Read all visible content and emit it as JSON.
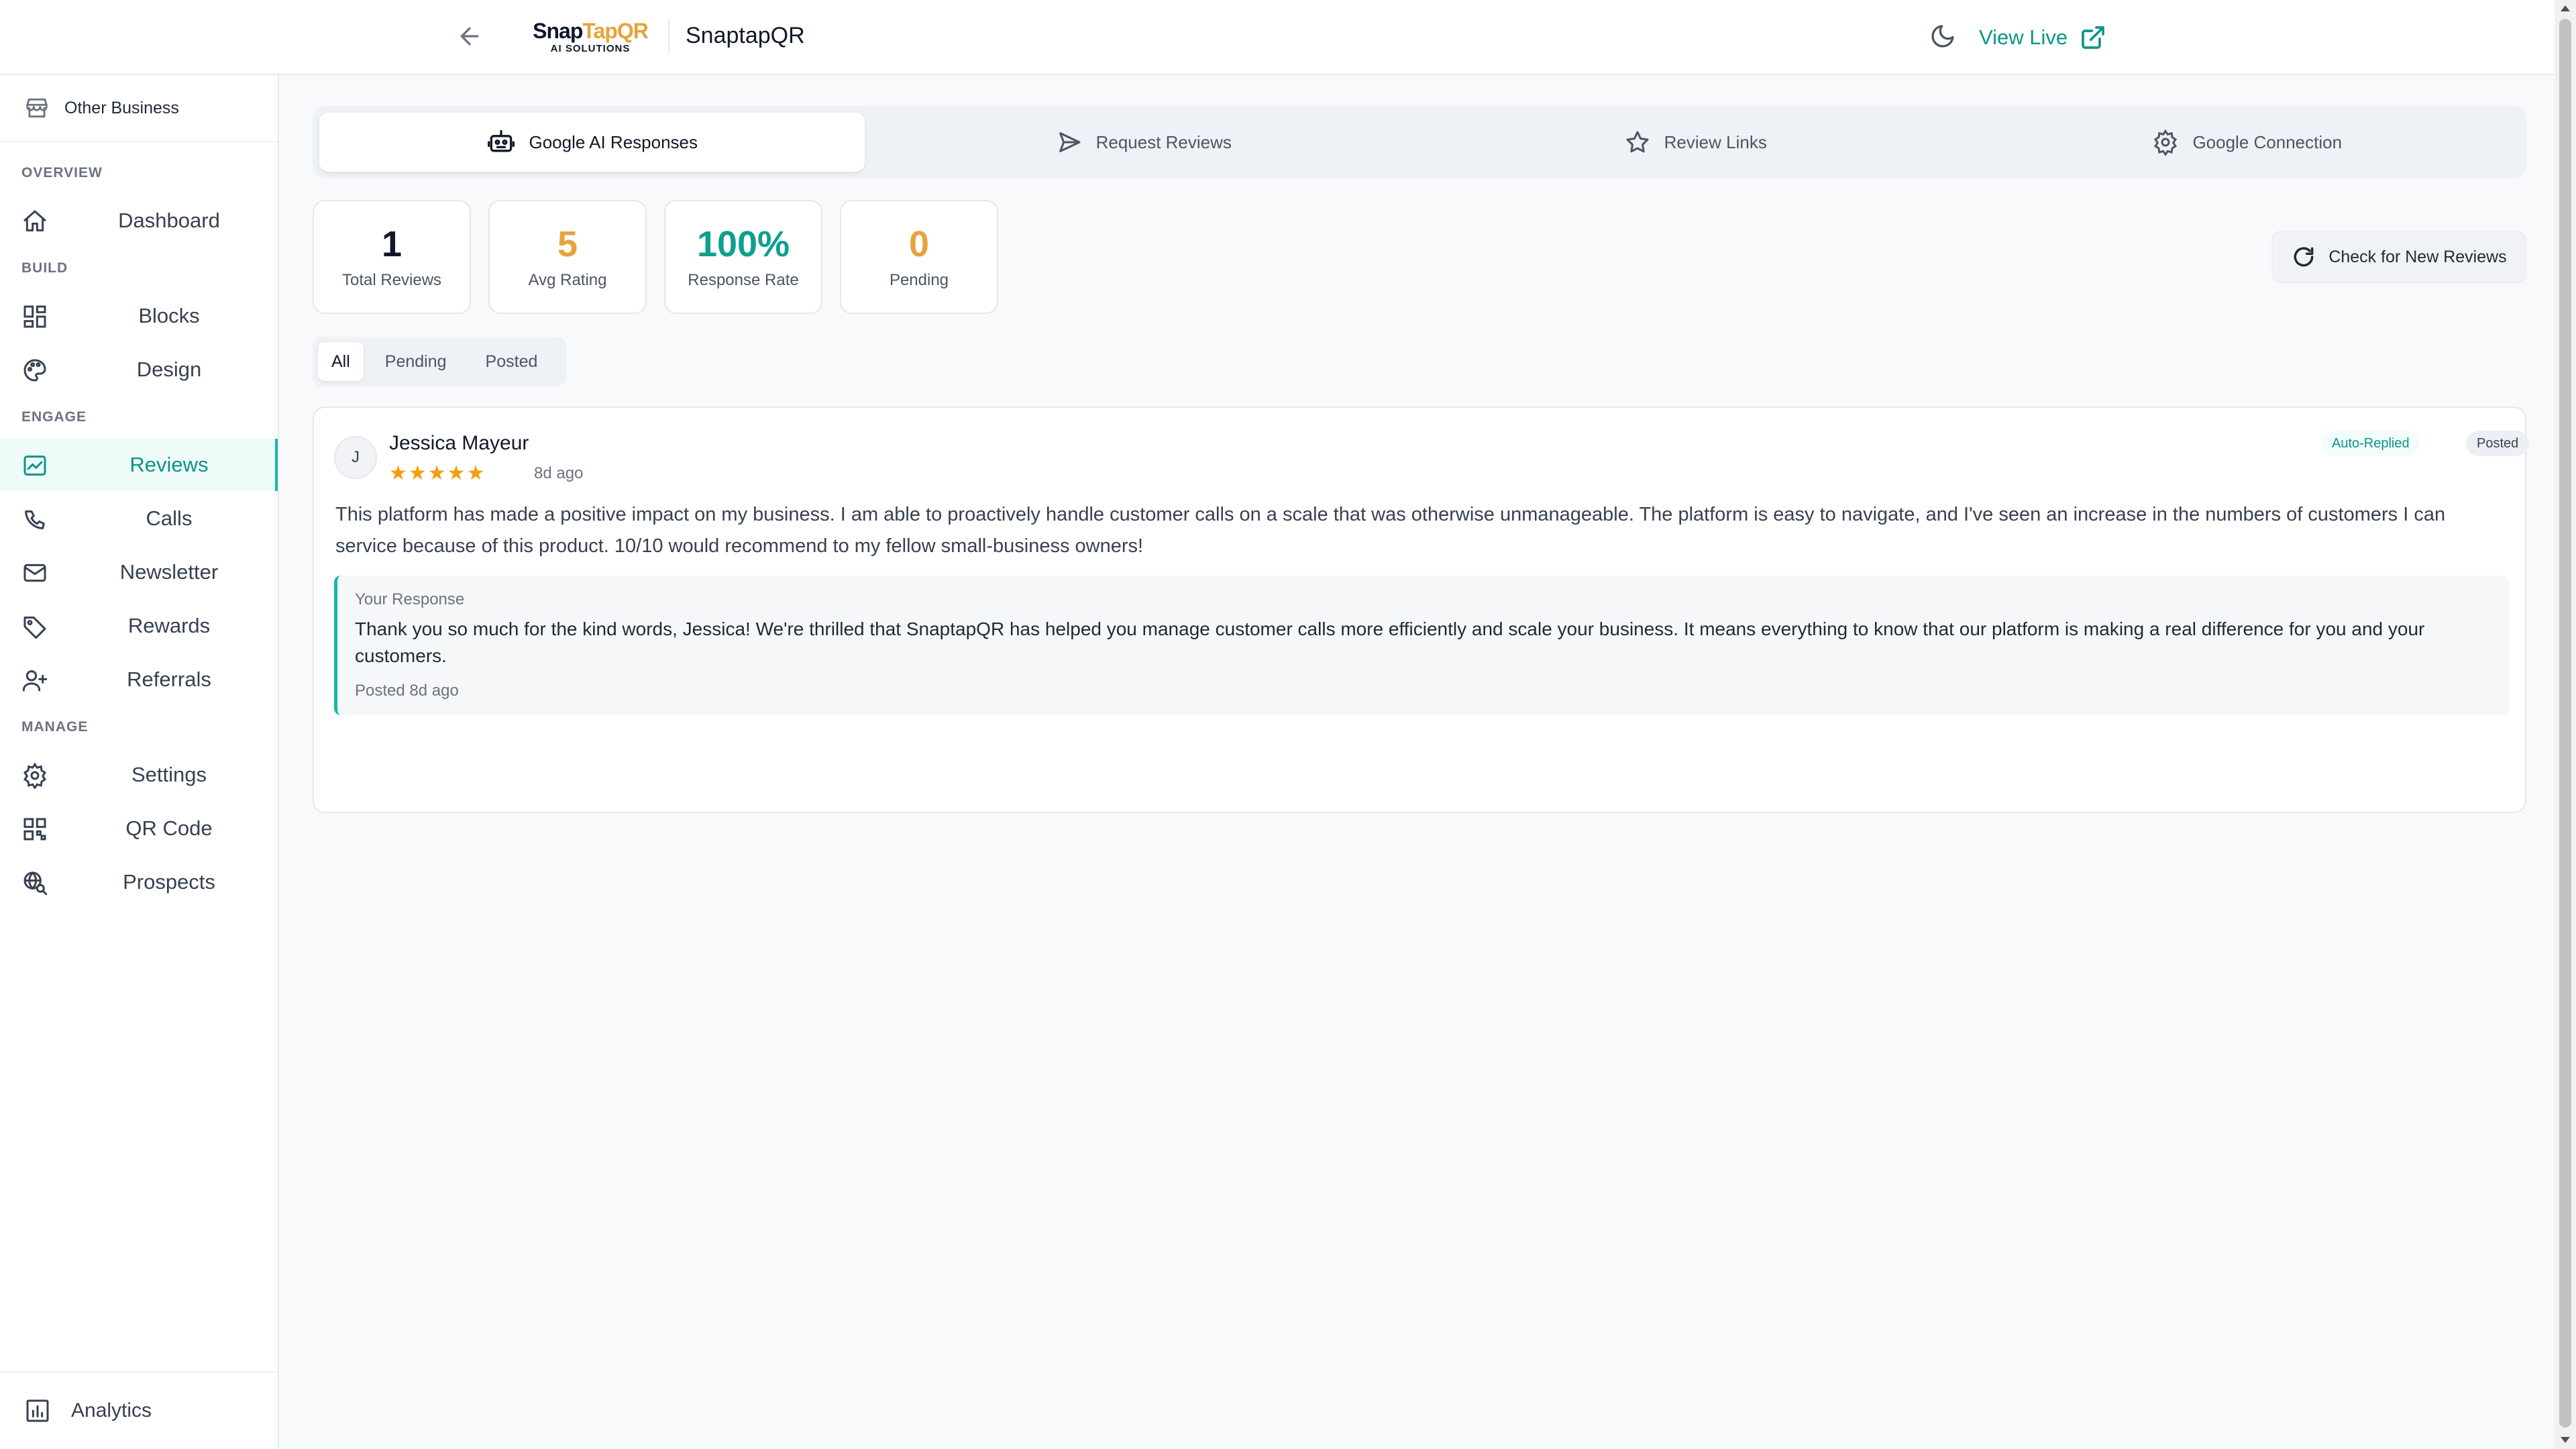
{
  "header": {
    "logo_main_a": "Snap",
    "logo_main_b": "TapQR",
    "logo_sub": "AI SOLUTIONS",
    "brand_name": "SnaptapQR",
    "view_live_label": "View Live"
  },
  "sidebar": {
    "business_label": "Other Business",
    "sections": {
      "overview": "OVERVIEW",
      "build": "BUILD",
      "engage": "ENGAGE",
      "manage": "MANAGE"
    },
    "items": {
      "dashboard": "Dashboard",
      "blocks": "Blocks",
      "design": "Design",
      "reviews": "Reviews",
      "calls": "Calls",
      "newsletter": "Newsletter",
      "rewards": "Rewards",
      "referrals": "Referrals",
      "settings": "Settings",
      "qr_code": "QR Code",
      "prospects": "Prospects"
    },
    "active_item": "Reviews",
    "bottom_label": "Analytics"
  },
  "tabs": {
    "ai_responses": "Google AI Responses",
    "request_reviews": "Request Reviews",
    "review_links": "Review Links",
    "google_connection": "Google Connection"
  },
  "stats": {
    "total_reviews": {
      "value": "1",
      "label": "Total Reviews",
      "color": "#111827"
    },
    "avg_rating": {
      "value": "5",
      "label": "Avg Rating",
      "color": "#e8a23a"
    },
    "response_rate": {
      "value": "100%",
      "label": "Response Rate",
      "color": "#0f9f8f"
    },
    "pending": {
      "value": "0",
      "label": "Pending",
      "color": "#e8a23a"
    }
  },
  "check_button_label": "Check for New Reviews",
  "filters": {
    "all": "All",
    "pending": "Pending",
    "posted": "Posted"
  },
  "review": {
    "avatar_initial": "J",
    "name": "Jessica Mayeur",
    "stars": "★★★★★",
    "rating": 5,
    "time": "8d ago",
    "badge_auto": "Auto-Replied",
    "badge_posted": "Posted",
    "text": "This platform has made a positive impact on my business. I am able to proactively handle customer calls on a scale that was otherwise unmanageable. The platform is easy to navigate, and I've seen an increase in the numbers of customers I can service because of this product. 10/10 would recommend to my fellow small-business owners!",
    "response_label": "Your Response",
    "response_text": "Thank you so much for the kind words, Jessica! We're thrilled that SnaptapQR has helped you manage customer calls more efficiently and scale your business. It means everything to know that our platform is making a real difference for you and your customers.",
    "response_posted": "Posted 8d ago"
  },
  "colors": {
    "accent": "#0d9488",
    "accent_light": "#14b8a6",
    "star": "#f59e0b",
    "brand_orange": "#e8a23a"
  }
}
